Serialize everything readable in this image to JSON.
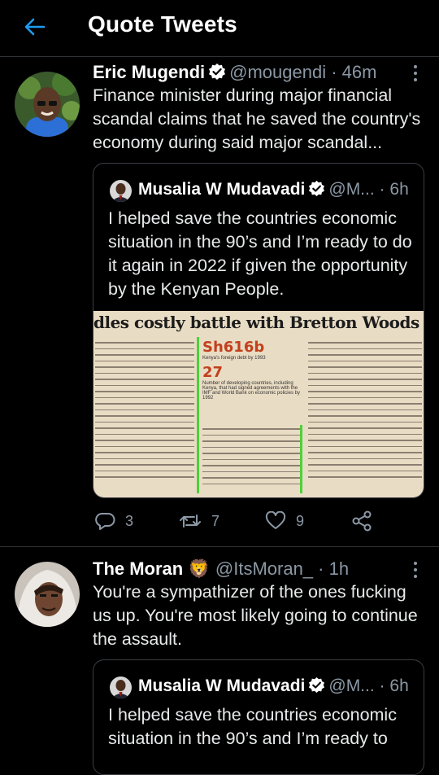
{
  "header": {
    "title": "Quote Tweets",
    "back_icon": "back-arrow-icon",
    "accent": "#1d9bf0"
  },
  "tweets": [
    {
      "name": "Eric Mugendi",
      "handle": "@mougendi",
      "sep": "·",
      "time": "46m",
      "text": "Finance minister during major financial scandal claims that he saved the country's economy during said major scandal...",
      "quote": {
        "name": "Musalia W Mudavadi",
        "handle": "@M...",
        "sep": "·",
        "time": "6h",
        "text": "I helped save the countries economic situation in the 90’s and I’m ready to do it again in 2022 if given the opportunity by the Kenyan People.",
        "image": {
          "headline": "dles costly battle with Bretton Woods ins",
          "figure1": "Sh616b",
          "figure1_caption": "Kenya's foreign debt by 1993",
          "figure2": "27",
          "figure2_caption": "Number of developing countries, including Kenya, that had signed agreements with the IMF and World Bank on economic policies by 1992"
        }
      },
      "actions": {
        "replies": "3",
        "retweets": "7",
        "likes": "9"
      }
    },
    {
      "name": "The Moran",
      "name_emoji": "🦁",
      "handle": "@ItsMoran_",
      "sep": "·",
      "time": "1h",
      "text": "You're a sympathizer of the ones fucking us up. You're most likely going to continue the assault.",
      "quote": {
        "name": "Musalia W Mudavadi",
        "handle": "@M...",
        "sep": "·",
        "time": "6h",
        "text": "I helped save the countries economic situation in the 90’s and I’m ready to"
      }
    }
  ],
  "colors": {
    "muted": "#8b98a5",
    "border": "#2f3336",
    "verified": "#ffffff"
  }
}
